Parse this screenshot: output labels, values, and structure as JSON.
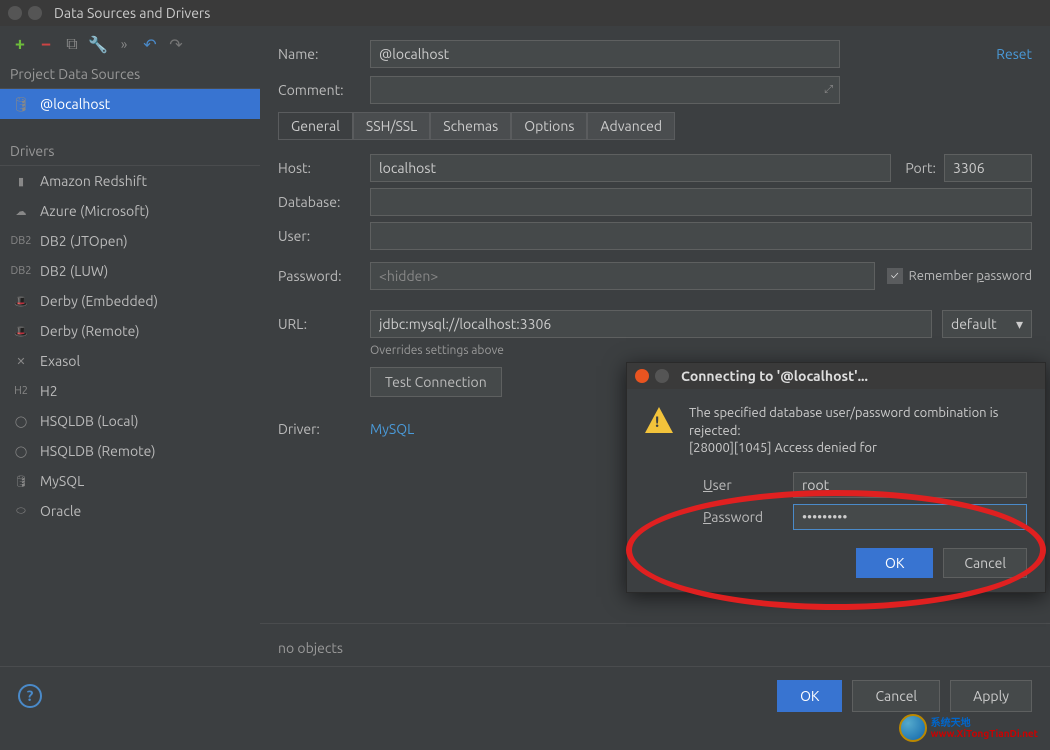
{
  "title": "Data Sources and Drivers",
  "sidebar": {
    "sections": {
      "project": "Project Data Sources",
      "drivers": "Drivers"
    },
    "selected": "@localhost",
    "drivers": [
      "Amazon Redshift",
      "Azure (Microsoft)",
      "DB2 (JTOpen)",
      "DB2 (LUW)",
      "Derby (Embedded)",
      "Derby (Remote)",
      "Exasol",
      "H2",
      "HSQLDB (Local)",
      "HSQLDB (Remote)",
      "MySQL",
      "Oracle"
    ]
  },
  "detail": {
    "labels": {
      "name": "Name:",
      "comment": "Comment:",
      "host": "Host:",
      "port": "Port:",
      "database": "Database:",
      "user": "User:",
      "password": "Password:",
      "url": "URL:",
      "driver": "Driver:"
    },
    "name": "@localhost",
    "reset": "Reset",
    "tabs": [
      "General",
      "SSH/SSL",
      "Schemas",
      "Options",
      "Advanced"
    ],
    "active_tab": "General",
    "host": "localhost",
    "port": "3306",
    "database": "",
    "user": "",
    "password_placeholder": "<hidden>",
    "remember_label": "Remember password",
    "remember_underline_char": "p",
    "url": "jdbc:mysql://localhost:3306",
    "url_mode": "default",
    "overrides": "Overrides settings above",
    "test_btn": "Test Connection",
    "driver": "MySQL",
    "no_objects": "no objects"
  },
  "dialog": {
    "title": "Connecting to '@localhost'...",
    "error": "The specified database user/password combination is rejected:\n[28000][1045] Access denied for",
    "user_label": "User",
    "password_label": "Password",
    "user_value": "root",
    "password_value": "•••••••••",
    "ok": "OK",
    "cancel": "Cancel"
  },
  "bottom": {
    "ok": "OK",
    "cancel": "Cancel",
    "apply": "Apply"
  },
  "watermark": {
    "line1": "系统天地",
    "line2": "www.XiTongTianDi.net"
  }
}
